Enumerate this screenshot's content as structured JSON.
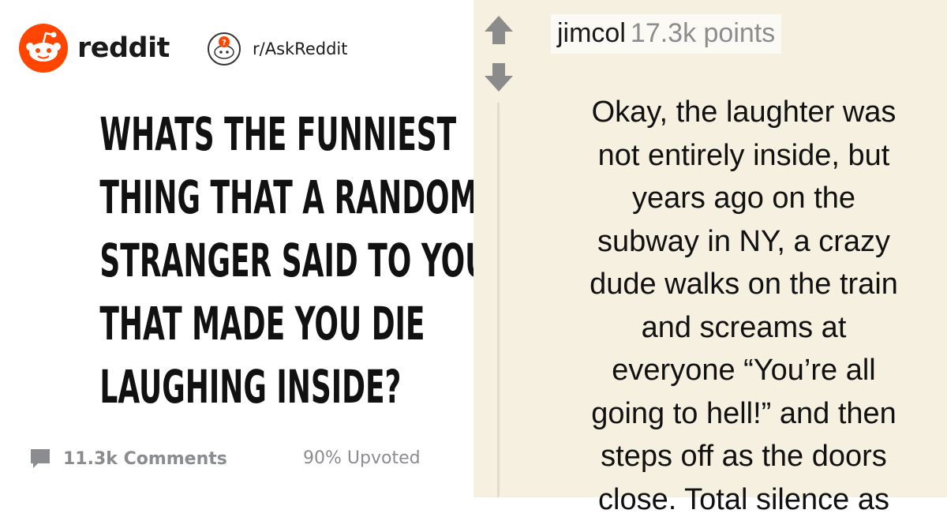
{
  "brand": {
    "name": "reddit"
  },
  "subreddit": {
    "name": "r/AskReddit"
  },
  "post": {
    "title_lines": [
      "Whats the funniest",
      "thing that a random",
      "stranger said to you",
      "that made you die",
      "laughing inside?"
    ],
    "comments": "11.3k Comments",
    "upvoted": "90% Upvoted"
  },
  "comment": {
    "username": "jimcol",
    "points": "17.3k points",
    "body_lines": [
      "Okay, the laughter was",
      "not entirely inside, but",
      "years ago on the",
      "subway in NY, a crazy",
      "dude walks on the train",
      "and screams at",
      "everyone “You’re all",
      "going to hell!” and then",
      "steps off as the doors",
      "close. Total silence as"
    ]
  },
  "icons": {
    "brand": "reddit-alien-icon",
    "subreddit": "askreddit-icon",
    "comments": "speech-bubble-icon",
    "upvote": "upvote-arrow-icon",
    "downvote": "downvote-arrow-icon"
  },
  "colors": {
    "reddit_orange": "#ff4500",
    "meta_gray": "#8a8c8f",
    "comment_bg": "#f6f0e1",
    "arrow_gray": "#8b8b8b"
  }
}
